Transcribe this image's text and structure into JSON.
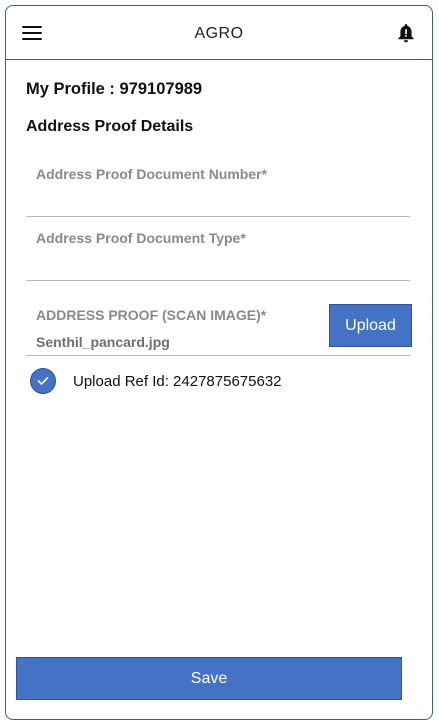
{
  "header": {
    "title": "AGRO",
    "menu_icon": "hamburger-menu-icon",
    "notification_icon": "bell-icon"
  },
  "profile": {
    "title": "My Profile : 979107989"
  },
  "section": {
    "title": "Address Proof Details"
  },
  "fields": {
    "document_number": {
      "label": "Address Proof Document Number*",
      "value": ""
    },
    "document_type": {
      "label": "Address Proof Document Type*",
      "value": ""
    }
  },
  "upload": {
    "label": "ADDRESS PROOF (SCAN IMAGE)*",
    "file_name": "Senthil_pancard.jpg",
    "button_label": "Upload",
    "ref_text": "Upload Ref Id: 2427875675632",
    "status_icon": "check-circle-icon"
  },
  "footer": {
    "save_label": "Save"
  },
  "colors": {
    "accent": "#4472c4",
    "border": "#3b5f8a",
    "label_gray": "#8a8a8a"
  }
}
